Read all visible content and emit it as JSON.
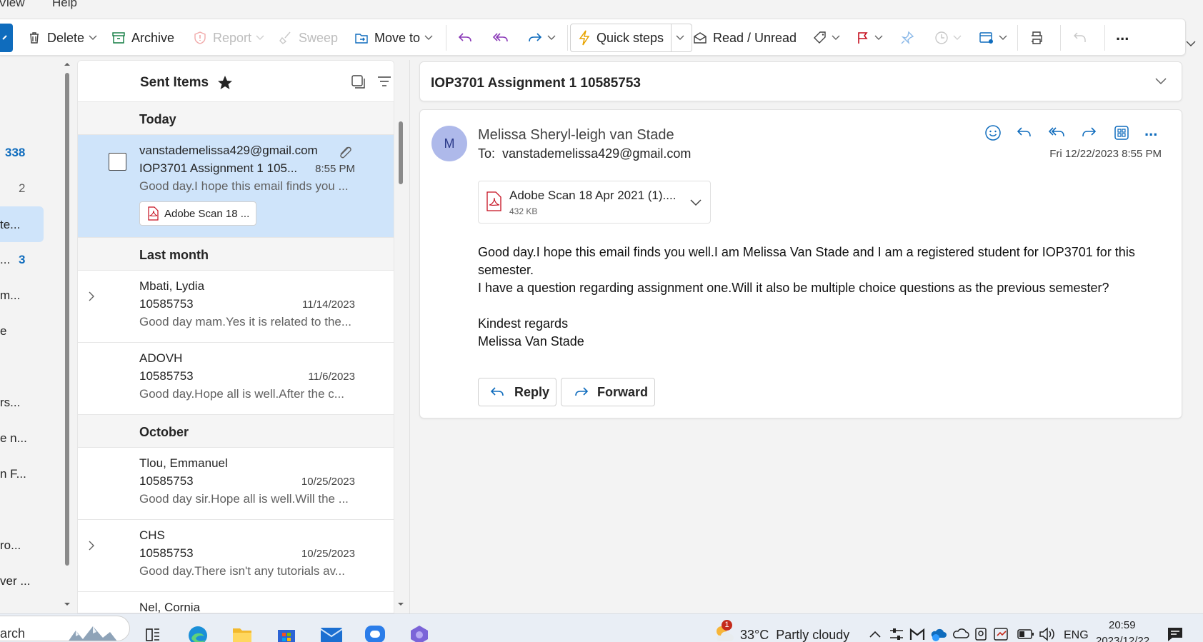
{
  "menu": {
    "view": "View",
    "help": "Help"
  },
  "toolbar": {
    "delete": "Delete",
    "archive": "Archive",
    "report": "Report",
    "sweep": "Sweep",
    "move_to": "Move to",
    "quick_steps": "Quick steps",
    "read_unread": "Read / Unread",
    "more": "..."
  },
  "folders": {
    "inbox_count": "338",
    "item2_count": "2",
    "item3_label": "te...",
    "item4_label": "...",
    "item4_count": "3",
    "item5_label": "m...",
    "item6_label": "e",
    "item7_label": "rs...",
    "item8_label": "e n...",
    "item9_label": "n F...",
    "item10_label": "ro...",
    "item11_label": "ver ..."
  },
  "list": {
    "title": "Sent Items",
    "groups": {
      "today": "Today",
      "last_month": "Last month",
      "october": "October"
    },
    "messages": [
      {
        "from": "vanstademelissa429@gmail.com",
        "subject": "IOP3701 Assignment 1 105...",
        "date": "8:55 PM",
        "preview": "Good day.I hope this email finds you ...",
        "attachment": "Adobe Scan 18 ..."
      },
      {
        "from": "Mbati, Lydia",
        "subject": "10585753",
        "date": "11/14/2023",
        "preview": "Good day mam.Yes it is related to the..."
      },
      {
        "from": "ADOVH",
        "subject": "10585753",
        "date": "11/6/2023",
        "preview": "Good day.Hope all is well.After the c..."
      },
      {
        "from": "Tlou, Emmanuel",
        "subject": "10585753",
        "date": "10/25/2023",
        "preview": "Good day sir.Hope all is well.Will the ..."
      },
      {
        "from": "CHS",
        "subject": "10585753",
        "date": "10/25/2023",
        "preview": "Good day.There isn't any tutorials av..."
      },
      {
        "from": "Nel, Cornia"
      }
    ]
  },
  "reading": {
    "subject": "IOP3701 Assignment 1 10585753",
    "avatar_initial": "M",
    "sender": "Melissa Sheryl-leigh van Stade",
    "to": "To:  vanstademelissa429@gmail.com",
    "date": "Fri 12/22/2023 8:55 PM",
    "attachment_name": "Adobe Scan 18 Apr 2021 (1)....",
    "attachment_size": "432 KB",
    "body": [
      "Good day.I hope this email finds you well.I am Melissa Van Stade and I am a registered student for IOP3701 for this semester.",
      "I have a question regarding assignment one.Will it also be multiple choice questions as the previous semester?",
      "",
      "Kindest regards",
      "Melissa Van Stade"
    ],
    "reply": "Reply",
    "forward": "Forward"
  },
  "taskbar": {
    "search": "arch",
    "weather_badge": "1",
    "weather": "33°C  Partly cloudy",
    "lang": "ENG",
    "time": "20:59",
    "date": "2023/12/22"
  }
}
